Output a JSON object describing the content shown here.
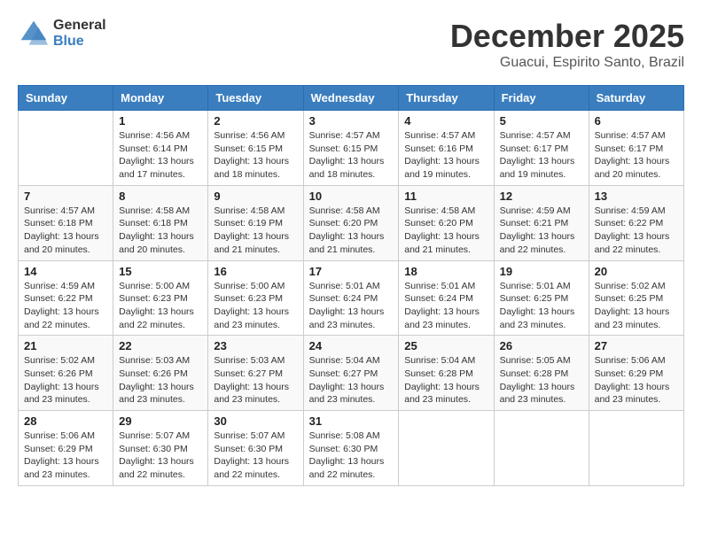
{
  "logo": {
    "general": "General",
    "blue": "Blue"
  },
  "header": {
    "month": "December 2025",
    "location": "Guacui, Espirito Santo, Brazil"
  },
  "weekdays": [
    "Sunday",
    "Monday",
    "Tuesday",
    "Wednesday",
    "Thursday",
    "Friday",
    "Saturday"
  ],
  "weeks": [
    [
      {
        "day": "",
        "info": ""
      },
      {
        "day": "1",
        "info": "Sunrise: 4:56 AM\nSunset: 6:14 PM\nDaylight: 13 hours\nand 17 minutes."
      },
      {
        "day": "2",
        "info": "Sunrise: 4:56 AM\nSunset: 6:15 PM\nDaylight: 13 hours\nand 18 minutes."
      },
      {
        "day": "3",
        "info": "Sunrise: 4:57 AM\nSunset: 6:15 PM\nDaylight: 13 hours\nand 18 minutes."
      },
      {
        "day": "4",
        "info": "Sunrise: 4:57 AM\nSunset: 6:16 PM\nDaylight: 13 hours\nand 19 minutes."
      },
      {
        "day": "5",
        "info": "Sunrise: 4:57 AM\nSunset: 6:17 PM\nDaylight: 13 hours\nand 19 minutes."
      },
      {
        "day": "6",
        "info": "Sunrise: 4:57 AM\nSunset: 6:17 PM\nDaylight: 13 hours\nand 20 minutes."
      }
    ],
    [
      {
        "day": "7",
        "info": "Sunrise: 4:57 AM\nSunset: 6:18 PM\nDaylight: 13 hours\nand 20 minutes."
      },
      {
        "day": "8",
        "info": "Sunrise: 4:58 AM\nSunset: 6:18 PM\nDaylight: 13 hours\nand 20 minutes."
      },
      {
        "day": "9",
        "info": "Sunrise: 4:58 AM\nSunset: 6:19 PM\nDaylight: 13 hours\nand 21 minutes."
      },
      {
        "day": "10",
        "info": "Sunrise: 4:58 AM\nSunset: 6:20 PM\nDaylight: 13 hours\nand 21 minutes."
      },
      {
        "day": "11",
        "info": "Sunrise: 4:58 AM\nSunset: 6:20 PM\nDaylight: 13 hours\nand 21 minutes."
      },
      {
        "day": "12",
        "info": "Sunrise: 4:59 AM\nSunset: 6:21 PM\nDaylight: 13 hours\nand 22 minutes."
      },
      {
        "day": "13",
        "info": "Sunrise: 4:59 AM\nSunset: 6:22 PM\nDaylight: 13 hours\nand 22 minutes."
      }
    ],
    [
      {
        "day": "14",
        "info": "Sunrise: 4:59 AM\nSunset: 6:22 PM\nDaylight: 13 hours\nand 22 minutes."
      },
      {
        "day": "15",
        "info": "Sunrise: 5:00 AM\nSunset: 6:23 PM\nDaylight: 13 hours\nand 22 minutes."
      },
      {
        "day": "16",
        "info": "Sunrise: 5:00 AM\nSunset: 6:23 PM\nDaylight: 13 hours\nand 23 minutes."
      },
      {
        "day": "17",
        "info": "Sunrise: 5:01 AM\nSunset: 6:24 PM\nDaylight: 13 hours\nand 23 minutes."
      },
      {
        "day": "18",
        "info": "Sunrise: 5:01 AM\nSunset: 6:24 PM\nDaylight: 13 hours\nand 23 minutes."
      },
      {
        "day": "19",
        "info": "Sunrise: 5:01 AM\nSunset: 6:25 PM\nDaylight: 13 hours\nand 23 minutes."
      },
      {
        "day": "20",
        "info": "Sunrise: 5:02 AM\nSunset: 6:25 PM\nDaylight: 13 hours\nand 23 minutes."
      }
    ],
    [
      {
        "day": "21",
        "info": "Sunrise: 5:02 AM\nSunset: 6:26 PM\nDaylight: 13 hours\nand 23 minutes."
      },
      {
        "day": "22",
        "info": "Sunrise: 5:03 AM\nSunset: 6:26 PM\nDaylight: 13 hours\nand 23 minutes."
      },
      {
        "day": "23",
        "info": "Sunrise: 5:03 AM\nSunset: 6:27 PM\nDaylight: 13 hours\nand 23 minutes."
      },
      {
        "day": "24",
        "info": "Sunrise: 5:04 AM\nSunset: 6:27 PM\nDaylight: 13 hours\nand 23 minutes."
      },
      {
        "day": "25",
        "info": "Sunrise: 5:04 AM\nSunset: 6:28 PM\nDaylight: 13 hours\nand 23 minutes."
      },
      {
        "day": "26",
        "info": "Sunrise: 5:05 AM\nSunset: 6:28 PM\nDaylight: 13 hours\nand 23 minutes."
      },
      {
        "day": "27",
        "info": "Sunrise: 5:06 AM\nSunset: 6:29 PM\nDaylight: 13 hours\nand 23 minutes."
      }
    ],
    [
      {
        "day": "28",
        "info": "Sunrise: 5:06 AM\nSunset: 6:29 PM\nDaylight: 13 hours\nand 23 minutes."
      },
      {
        "day": "29",
        "info": "Sunrise: 5:07 AM\nSunset: 6:30 PM\nDaylight: 13 hours\nand 22 minutes."
      },
      {
        "day": "30",
        "info": "Sunrise: 5:07 AM\nSunset: 6:30 PM\nDaylight: 13 hours\nand 22 minutes."
      },
      {
        "day": "31",
        "info": "Sunrise: 5:08 AM\nSunset: 6:30 PM\nDaylight: 13 hours\nand 22 minutes."
      },
      {
        "day": "",
        "info": ""
      },
      {
        "day": "",
        "info": ""
      },
      {
        "day": "",
        "info": ""
      }
    ]
  ]
}
